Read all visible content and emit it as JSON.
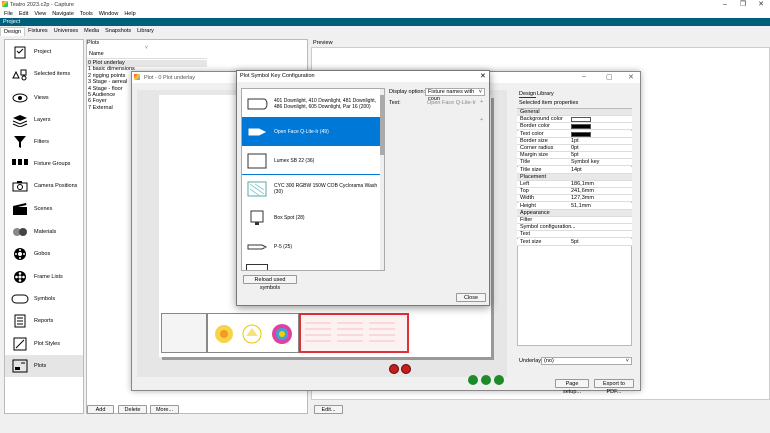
{
  "app": {
    "title": "Teatro 2023.c2p - Capture"
  },
  "menu": [
    "File",
    "Edit",
    "View",
    "Navigate",
    "Tools",
    "Window",
    "Help"
  ],
  "project_bar": "Project",
  "tabs": [
    "Design",
    "Fixtures",
    "Universes",
    "Media",
    "Snapshots",
    "Library"
  ],
  "sidebar": {
    "items": [
      {
        "label": "Project",
        "icon": "checklist-icon"
      },
      {
        "label": "Selected items",
        "icon": "shapes-icon"
      },
      {
        "label": "Views",
        "icon": "eye-icon"
      },
      {
        "label": "Layers",
        "icon": "layers-icon"
      },
      {
        "label": "Filters",
        "icon": "filter-icon"
      },
      {
        "label": "Fixture Groups",
        "icon": "fixture-groups-icon"
      },
      {
        "label": "Camera Positions",
        "icon": "camera-icon"
      },
      {
        "label": "Scenes",
        "icon": "clapperboard-icon"
      },
      {
        "label": "Materials",
        "icon": "materials-icon"
      },
      {
        "label": "Gobos",
        "icon": "gobo-icon"
      },
      {
        "label": "Frame Lists",
        "icon": "film-reel-icon"
      },
      {
        "label": "Symbols",
        "icon": "symbol-icon"
      },
      {
        "label": "Reports",
        "icon": "report-icon"
      },
      {
        "label": "Plot Styles",
        "icon": "plot-style-icon"
      },
      {
        "label": "Plots",
        "icon": "plots-icon"
      }
    ]
  },
  "plots": {
    "header": "Plots",
    "column": "Name",
    "rows": [
      "0 Plot underlay",
      "1 basic dimensions",
      "2 rigging points",
      "3 Stage - aereal",
      "4 Stage - floor",
      "5 Audience",
      "6 Foyer",
      "7 External"
    ],
    "add_label": "Add",
    "delete_label": "Delete",
    "more_label": "More..."
  },
  "preview": {
    "label": "Preview",
    "edit_label": "Edit..."
  },
  "plot_window": {
    "title": "Plot - 0 Plot underlay",
    "tabs": [
      "Design",
      "Library"
    ],
    "props_header": "Selected item properties",
    "properties": [
      {
        "key": "General",
        "section": true
      },
      {
        "key": "Background color",
        "swatch": "#ffffff"
      },
      {
        "key": "Border color",
        "swatch": "#000000"
      },
      {
        "key": "Text color",
        "swatch": "#000000"
      },
      {
        "key": "Border size",
        "value": "1pt"
      },
      {
        "key": "Corner radius",
        "value": "0pt"
      },
      {
        "key": "Margin size",
        "value": "5pt"
      },
      {
        "key": "Title",
        "value": "Symbol key"
      },
      {
        "key": "Title size",
        "value": "14pt"
      },
      {
        "key": "Placement",
        "section": true
      },
      {
        "key": "Left",
        "value": "186,1mm"
      },
      {
        "key": "Top",
        "value": "241,6mm"
      },
      {
        "key": "Width",
        "value": "127,3mm"
      },
      {
        "key": "Height",
        "value": "51,1mm"
      },
      {
        "key": "Appearance",
        "section": true
      },
      {
        "key": "Filter",
        "value": ""
      },
      {
        "key": "Symbol configuration",
        "value": "..."
      },
      {
        "key": "Text",
        "value": ""
      },
      {
        "key": "Text size",
        "value": "5pt"
      }
    ],
    "underlay_label": "Underlay:",
    "underlay_value": "(no)",
    "page_setup_label": "Page setup...",
    "export_label": "Export to PDF..."
  },
  "dialog": {
    "title": "Plot Symbol Key Configuration",
    "display_option_label": "Display option:",
    "display_option_value": "Fixture names with coun",
    "text_label": "Text:",
    "text_value": "Open Face Q-Lite-Ir",
    "symbols": [
      {
        "label": "401 Downlight, 410 Downlight, 481 Downlight, 486 Downlight, 605 Downlight, Par 16 (200)"
      },
      {
        "label": "Open Face Q-Lite-Ir (49)"
      },
      {
        "label": "Lumex SB 22 (36)"
      },
      {
        "label": "CYC 300 RGBW 150W COB Cyclorama Wash (30)"
      },
      {
        "label": "Box Spot (28)"
      },
      {
        "label": "P-5 (25)"
      }
    ],
    "selected_index": 1,
    "reload_label": "Reload used symbols",
    "close_label": "Close"
  },
  "colors": {
    "accent": "#0078d7",
    "project_bar": "#00607a",
    "selection_frame": "#e0303a"
  }
}
